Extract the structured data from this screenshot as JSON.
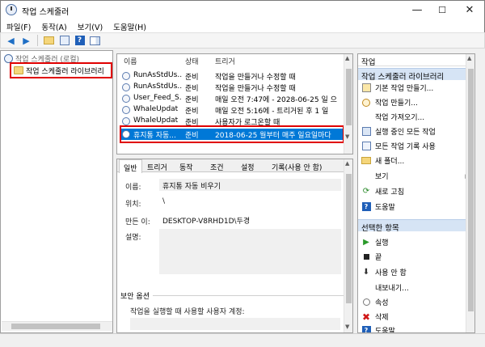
{
  "window": {
    "title": "작업 스케줄러",
    "minimize": "—",
    "maximize": "☐",
    "close": "✕"
  },
  "menu": [
    "파일(F)",
    "동작(A)",
    "보기(V)",
    "도움말(H)"
  ],
  "toolbar": {
    "icons": [
      "back-arrow-icon",
      "forward-arrow-icon",
      "folder-up-icon",
      "properties-icon",
      "help-icon",
      "show-hide-pane-icon"
    ]
  },
  "tree": {
    "root": "작업 스케줄러 (로컬)",
    "library": "작업 스케줄러 라이브러리"
  },
  "tasklist": {
    "columns": [
      "이름",
      "상태",
      "트리거"
    ],
    "rows": [
      {
        "name": "RunAsStdUs...",
        "status": "준비",
        "trigger": "작업을 만들거나 수정할 때"
      },
      {
        "name": "RunAsStdUs...",
        "status": "준비",
        "trigger": "작업을 만들거나 수정할 때"
      },
      {
        "name": "User_Feed_S...",
        "status": "준비",
        "trigger": "매일 오전 7:47에 - 2028-06-25 일 으"
      },
      {
        "name": "WhaleUpdat",
        "status": "준비",
        "trigger": "매일 오전 5:16에 - 트리거된 후 1 일"
      },
      {
        "name": "WhaleUpdat",
        "status": "준비",
        "trigger": "사용자가 로그온할 때"
      },
      {
        "name": "휴지통 자동...",
        "status": "준비",
        "trigger": "2018-06-25 월부터 매주 일요일마다"
      }
    ],
    "selected_index": 5
  },
  "details": {
    "tabs": [
      "일반",
      "트리거",
      "동작",
      "조건",
      "설정",
      "기록(사용 안 함)"
    ],
    "active_tab": 0,
    "fields": {
      "name_label": "이름:",
      "name_value": "휴지통 자동 비우기",
      "location_label": "위치:",
      "location_value": "\\",
      "author_label": "만든 이:",
      "author_value": "DESKTOP-V8RHD1D\\두경",
      "description_label": "설명:",
      "description_value": ""
    },
    "security_section": "보안 옵션",
    "security_text": "작업을 실행할 때 사용할 사용자 계정:"
  },
  "actions": {
    "title": "작업",
    "group1": "작업 스케줄러 라이브러리",
    "group1_items": [
      {
        "label": "기본 작업 만들기...",
        "icon": "wizard-icon"
      },
      {
        "label": "작업 만들기...",
        "icon": "create-task-icon"
      },
      {
        "label": "작업 가져오기...",
        "icon": ""
      },
      {
        "label": "실행 중인 모든 작업",
        "icon": "running-tasks-icon"
      },
      {
        "label": "모든 작업 기록 사용",
        "icon": "history-icon"
      },
      {
        "label": "새 폴더...",
        "icon": "new-folder-icon"
      },
      {
        "label": "보기",
        "icon": "",
        "submenu": true
      },
      {
        "label": "새로 고침",
        "icon": "refresh-icon"
      },
      {
        "label": "도움말",
        "icon": "help-icon"
      }
    ],
    "group2": "선택한 항목",
    "group2_items": [
      {
        "label": "실행",
        "icon": "run-icon"
      },
      {
        "label": "끝",
        "icon": "stop-icon"
      },
      {
        "label": "사용 안 함",
        "icon": "disable-icon"
      },
      {
        "label": "내보내기...",
        "icon": ""
      },
      {
        "label": "속성",
        "icon": "properties-icon"
      },
      {
        "label": "삭제",
        "icon": "delete-icon"
      },
      {
        "label": "도움말",
        "icon": "help-icon"
      }
    ]
  },
  "colors": {
    "selection": "#0078d7",
    "highlight_box": "#e00000",
    "action_header": "#d6e4f5"
  }
}
